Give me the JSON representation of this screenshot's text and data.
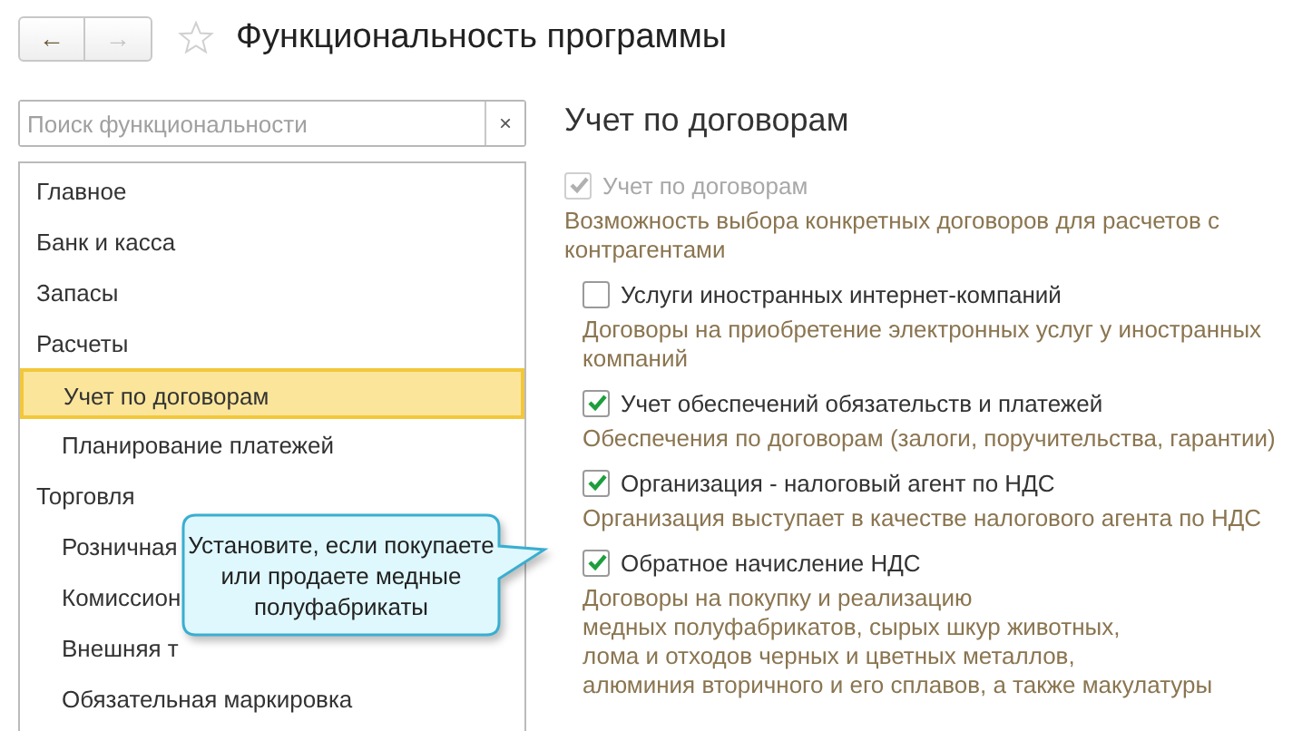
{
  "window": {
    "title": "Функциональность программы",
    "favorite": false
  },
  "nav": {
    "back": "←",
    "forward": "→",
    "forward_disabled": true
  },
  "search": {
    "placeholder": "Поиск функциональности",
    "clear": "×"
  },
  "sidebar": {
    "items": [
      {
        "label": "Главное",
        "selected": false
      },
      {
        "label": "Банк и касса",
        "selected": false
      },
      {
        "label": "Запасы",
        "selected": false
      },
      {
        "label": "Расчеты",
        "selected": false,
        "children": [
          {
            "label": "Учет по договорам",
            "selected": true
          },
          {
            "label": "Планирование платежей",
            "selected": false
          }
        ]
      },
      {
        "label": "Торговля",
        "selected": false,
        "children": [
          {
            "label": "Розничная",
            "selected": false
          },
          {
            "label": "Комиссион",
            "selected": false
          },
          {
            "label": "Внешняя т",
            "selected": false
          },
          {
            "label": "Обязательная маркировка",
            "selected": false
          }
        ]
      }
    ]
  },
  "section": {
    "title": "Учет по договорам",
    "main_option": {
      "label": "Учет по договорам",
      "checked": true,
      "disabled": true,
      "description": "Возможность выбора конкретных договоров для расчетов с контрагентами"
    },
    "options": [
      {
        "label": "Услуги иностранных интернет-компаний",
        "checked": false,
        "description": [
          "Договоры на приобретение электронных услуг у иностранных компаний"
        ]
      },
      {
        "label": "Учет обеспечений обязательств и платежей",
        "checked": true,
        "description": [
          "Обеспечения по договорам (залоги, поручительства, гарантии)"
        ]
      },
      {
        "label": "Организация - налоговый агент по НДС",
        "checked": true,
        "description": [
          "Организация выступает в качестве налогового агента по НДС"
        ]
      },
      {
        "label": "Обратное начисление НДС",
        "checked": true,
        "description": [
          "Договоры на покупку и реализацию",
          "медных полуфабрикатов, сырых шкур животных,",
          "лома и отходов черных и цветных металлов,",
          "алюминия вторичного и его сплавов, а также макулатуры"
        ]
      }
    ]
  },
  "callout": {
    "text": "Установите, если покупаете или продаете медные полуфабрикаты"
  }
}
